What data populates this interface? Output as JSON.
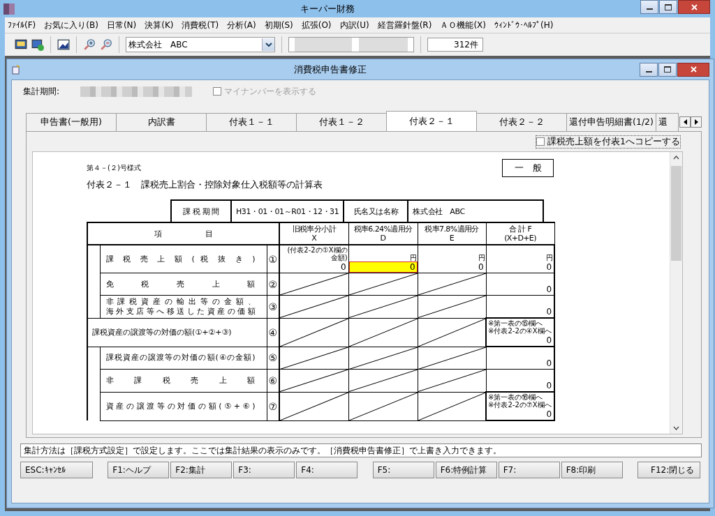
{
  "window": {
    "title": "キーパー財務"
  },
  "menu": [
    "ﾌｧｲﾙ(F)",
    "お気に入り(B)",
    "日常(N)",
    "決算(K)",
    "消費税(T)",
    "分析(A)",
    "初期(S)",
    "拡張(O)",
    "内訳(U)",
    "経営羅針盤(R)",
    "ＡＯ機能(X)",
    "ｳｨﾝﾄﾞｳ･ﾍﾙﾌﾟ(H)"
  ],
  "toolbar": {
    "company": "株式会社　ABC",
    "count": "312件"
  },
  "dialog": {
    "title": "消費税申告書修正",
    "period_label": "集計期間:",
    "mynumber": {
      "label": "マイナンバーを表示する",
      "checked": false,
      "disabled": true
    },
    "tabs": [
      {
        "label": "申告書(一般用)",
        "selected": false
      },
      {
        "label": "内訳書",
        "selected": false
      },
      {
        "label": "付表１－１",
        "selected": false
      },
      {
        "label": "付表１－２",
        "selected": false
      },
      {
        "label": "付表２－１",
        "selected": true
      },
      {
        "label": "付表２－２",
        "selected": false
      },
      {
        "label": "還付申告明細書(1/2)",
        "selected": false
      },
      {
        "label": "還",
        "selected": false
      }
    ],
    "copy_option": {
      "label": "課税売上額を付表1へコピーする",
      "checked": false
    },
    "document": {
      "form_number": "第４－(２)号様式",
      "title": "付表２－１　課税売上割合・控除対象仕入税額等の計算表",
      "category": "一　般",
      "period": {
        "label": "課 税 期 間",
        "value": "H31・01・01～R01・12・31",
        "name_label": "氏名又は名称",
        "name": "株式会社　ABC"
      },
      "headers": {
        "item": "項　　　　　　目",
        "columns": [
          [
            "旧税率分小計",
            "X"
          ],
          [
            "税率6.24%適用分",
            "D"
          ],
          [
            "税率7.8%適用分",
            "E"
          ],
          [
            "合 計 F",
            "(X+D+E)"
          ]
        ]
      },
      "rows": [
        {
          "label": [
            "課 税 売 上 額 ( 税 抜 き )"
          ],
          "number": "①",
          "indent": true,
          "cells": [
            {
              "kind": "value",
              "notes": [
                "(付表2-2の①X欄の金額)"
              ],
              "value": "0",
              "focused": false
            },
            {
              "kind": "value",
              "notes": [
                "円"
              ],
              "value": "0",
              "focused": true
            },
            {
              "kind": "value",
              "notes": [
                "円"
              ],
              "value": "0",
              "focused": false
            },
            {
              "kind": "value",
              "notes": [
                "円"
              ],
              "value": "0",
              "focused": false
            }
          ]
        },
        {
          "label": [
            "免 税 売 上 額"
          ],
          "number": "②",
          "indent": true,
          "cells": [
            {
              "kind": "hatched"
            },
            {
              "kind": "hatched"
            },
            {
              "kind": "hatched"
            },
            {
              "kind": "value",
              "value": "0",
              "focused": false
            }
          ]
        },
        {
          "label": [
            "非課税資産の輸出等の金額、",
            "海外支店等へ移送した資産の価額"
          ],
          "number": "③",
          "indent": true,
          "cells": [
            {
              "kind": "hatched"
            },
            {
              "kind": "hatched"
            },
            {
              "kind": "hatched"
            },
            {
              "kind": "value",
              "value": "0",
              "focused": false
            }
          ]
        },
        {
          "label": [
            "課税資産の譲渡等の対価の額(①+②+③)"
          ],
          "number": "④",
          "indent": false,
          "cells": [
            {
              "kind": "hatched"
            },
            {
              "kind": "hatched"
            },
            {
              "kind": "hatched"
            },
            {
              "kind": "boxed",
              "notes": [
                "※第一表の⑮欄へ",
                "※付表2-2の④X欄へ"
              ],
              "value": "0",
              "focused": false
            }
          ]
        },
        {
          "label": [
            "課税資産の譲渡等の対価の額(④の金額)"
          ],
          "number": "⑤",
          "indent": true,
          "cells": [
            {
              "kind": "hatched"
            },
            {
              "kind": "hatched"
            },
            {
              "kind": "hatched"
            },
            {
              "kind": "value",
              "value": "0",
              "focused": false
            }
          ]
        },
        {
          "label": [
            "非 課 税 売 上 額"
          ],
          "number": "⑥",
          "indent": true,
          "cells": [
            {
              "kind": "hatched"
            },
            {
              "kind": "hatched"
            },
            {
              "kind": "hatched"
            },
            {
              "kind": "value",
              "value": "0",
              "focused": false
            }
          ]
        },
        {
          "label": [
            "資 産 の 譲 渡 等 の 対 価 の 額 ( ⑤ + ⑥ )"
          ],
          "number": "⑦",
          "indent": true,
          "cells": [
            {
              "kind": "hatched"
            },
            {
              "kind": "hatched"
            },
            {
              "kind": "hatched"
            },
            {
              "kind": "boxed",
              "notes": [
                "※第一表の⑯欄へ",
                "※付表2-2の⑦X欄へ"
              ],
              "value": "0",
              "focused": false
            }
          ]
        }
      ]
    },
    "message": "集計方法は［課税方式設定］で設定します。ここでは集計結果の表示のみです。［消費税申告書修正］で上書き入力できます。",
    "button_groups": [
      [
        "ESC:ｷｬﾝｾﾙ"
      ],
      [
        "F1:ヘルプ",
        "F2:集計",
        "F3:",
        "F4:"
      ],
      [
        "F5:",
        "F6:特例計算",
        "F7:",
        "F8:印刷"
      ],
      [
        "F12:閉じる"
      ]
    ]
  }
}
